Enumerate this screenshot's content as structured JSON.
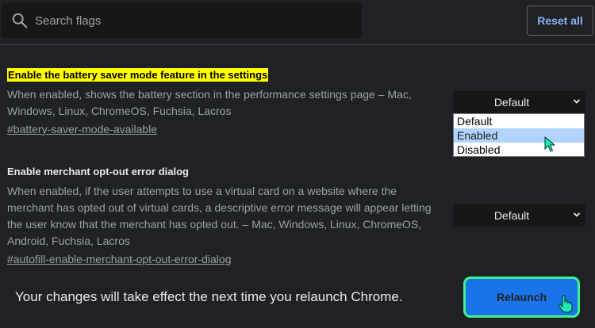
{
  "search": {
    "placeholder": "Search flags"
  },
  "header": {
    "reset_label": "Reset all"
  },
  "flags": [
    {
      "title": "Enable the battery saver mode feature in the settings",
      "description": "When enabled, shows the battery section in the performance settings page – Mac, Windows, Linux, ChromeOS, Fuchsia, Lacros",
      "link": "#battery-saver-mode-available",
      "select_value": "Default",
      "options": [
        "Default",
        "Enabled",
        "Disabled"
      ],
      "highlighted_option": "Enabled"
    },
    {
      "title": "Enable merchant opt-out error dialog",
      "description": "When enabled, if the user attempts to use a virtual card on a website where the merchant has opted out of virtual cards, a descriptive error message will appear letting the user know that the merchant has opted out. – Mac, Windows, Linux, ChromeOS, Android, Fuchsia, Lacros",
      "link": "#autofill-enable-merchant-opt-out-error-dialog",
      "select_value": "Default"
    }
  ],
  "footer": {
    "message": "Your changes will take effect the next time you relaunch Chrome.",
    "relaunch_label": "Relaunch"
  },
  "colors": {
    "background": "#202124",
    "accent": "#8ab4f8",
    "relaunch_bg": "#1a73e8",
    "highlight": "#ffff00",
    "relaunch_border": "#3df38d"
  },
  "icons": [
    "search-icon",
    "chevron-down-icon",
    "cursor-arrow-icon",
    "hand-pointer-icon"
  ]
}
